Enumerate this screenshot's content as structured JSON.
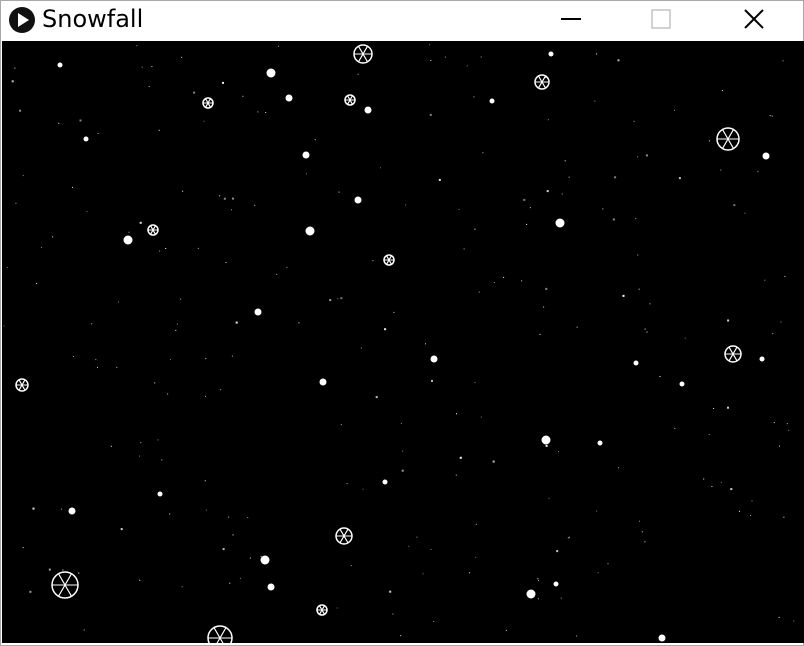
{
  "window": {
    "title": "Snowfall",
    "app_icon": "play-circle-icon",
    "controls": [
      {
        "name": "minimize-button",
        "icon": "minimize-icon"
      },
      {
        "name": "maximize-button",
        "icon": "maximize-icon"
      },
      {
        "name": "close-button",
        "icon": "close-icon"
      }
    ]
  },
  "canvas": {
    "background": "#000000",
    "snow_color": "#ffffff"
  }
}
